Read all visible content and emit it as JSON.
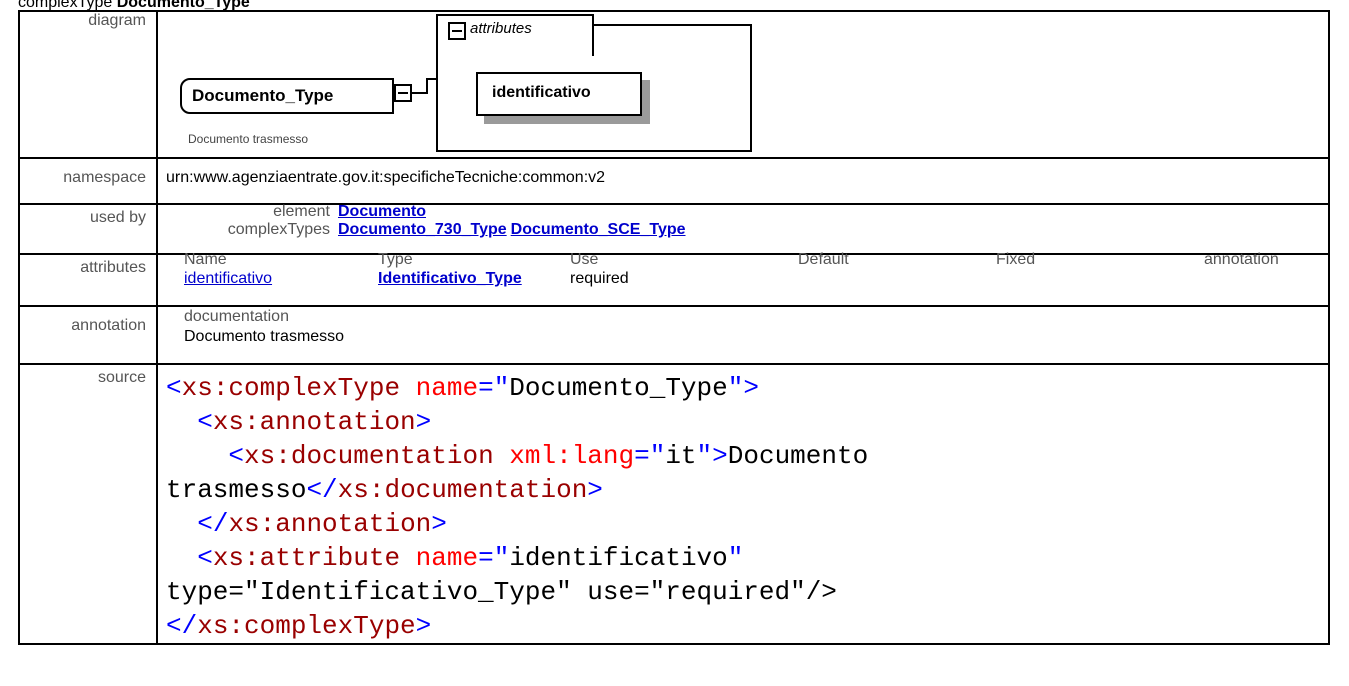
{
  "header": {
    "kind": "complexType",
    "name": "Documento_Type"
  },
  "labels": {
    "diagram": "diagram",
    "namespace": "namespace",
    "used_by": "used by",
    "attributes": "attributes",
    "annotation": "annotation",
    "source": "source"
  },
  "diagram": {
    "element_name": "Documento_Type",
    "element_doc": "Documento trasmesso",
    "attributes_group_title": "attributes",
    "attribute_name": "identificativo"
  },
  "namespace": {
    "value": "urn:www.agenziaentrate.gov.it:specificheTecniche:common:v2"
  },
  "used_by": {
    "element_label": "element",
    "element_links": [
      "Documento"
    ],
    "complextypes_label": "complexTypes",
    "complextype_links": [
      "Documento_730_Type",
      "Documento_SCE_Type"
    ]
  },
  "attributes_table": {
    "headers": [
      "Name",
      "Type",
      "Use",
      "Default",
      "Fixed",
      "annotation"
    ],
    "rows": [
      {
        "name": "identificativo",
        "type": "Identificativo_Type",
        "use": "required",
        "default": "",
        "fixed": "",
        "annotation": ""
      }
    ]
  },
  "annotation": {
    "heading": "documentation",
    "text": "Documento trasmesso"
  },
  "source": {
    "lines": [
      "<xs:complexType name=\"Documento_Type\">",
      "  <xs:annotation>",
      "    <xs:documentation xml:lang=\"it\">Documento",
      "trasmesso</xs:documentation>",
      "  </xs:annotation>",
      "  <xs:attribute name=\"identificativo\"",
      "type=\"Identificativo_Type\" use=\"required\"/>",
      "</xs:complexType>"
    ]
  },
  "colors": {
    "link": "#0000cc",
    "xml_bracket": "#0000ff",
    "xml_tag": "#990000",
    "xml_attr": "#ff0000",
    "label_gray": "#555555"
  }
}
